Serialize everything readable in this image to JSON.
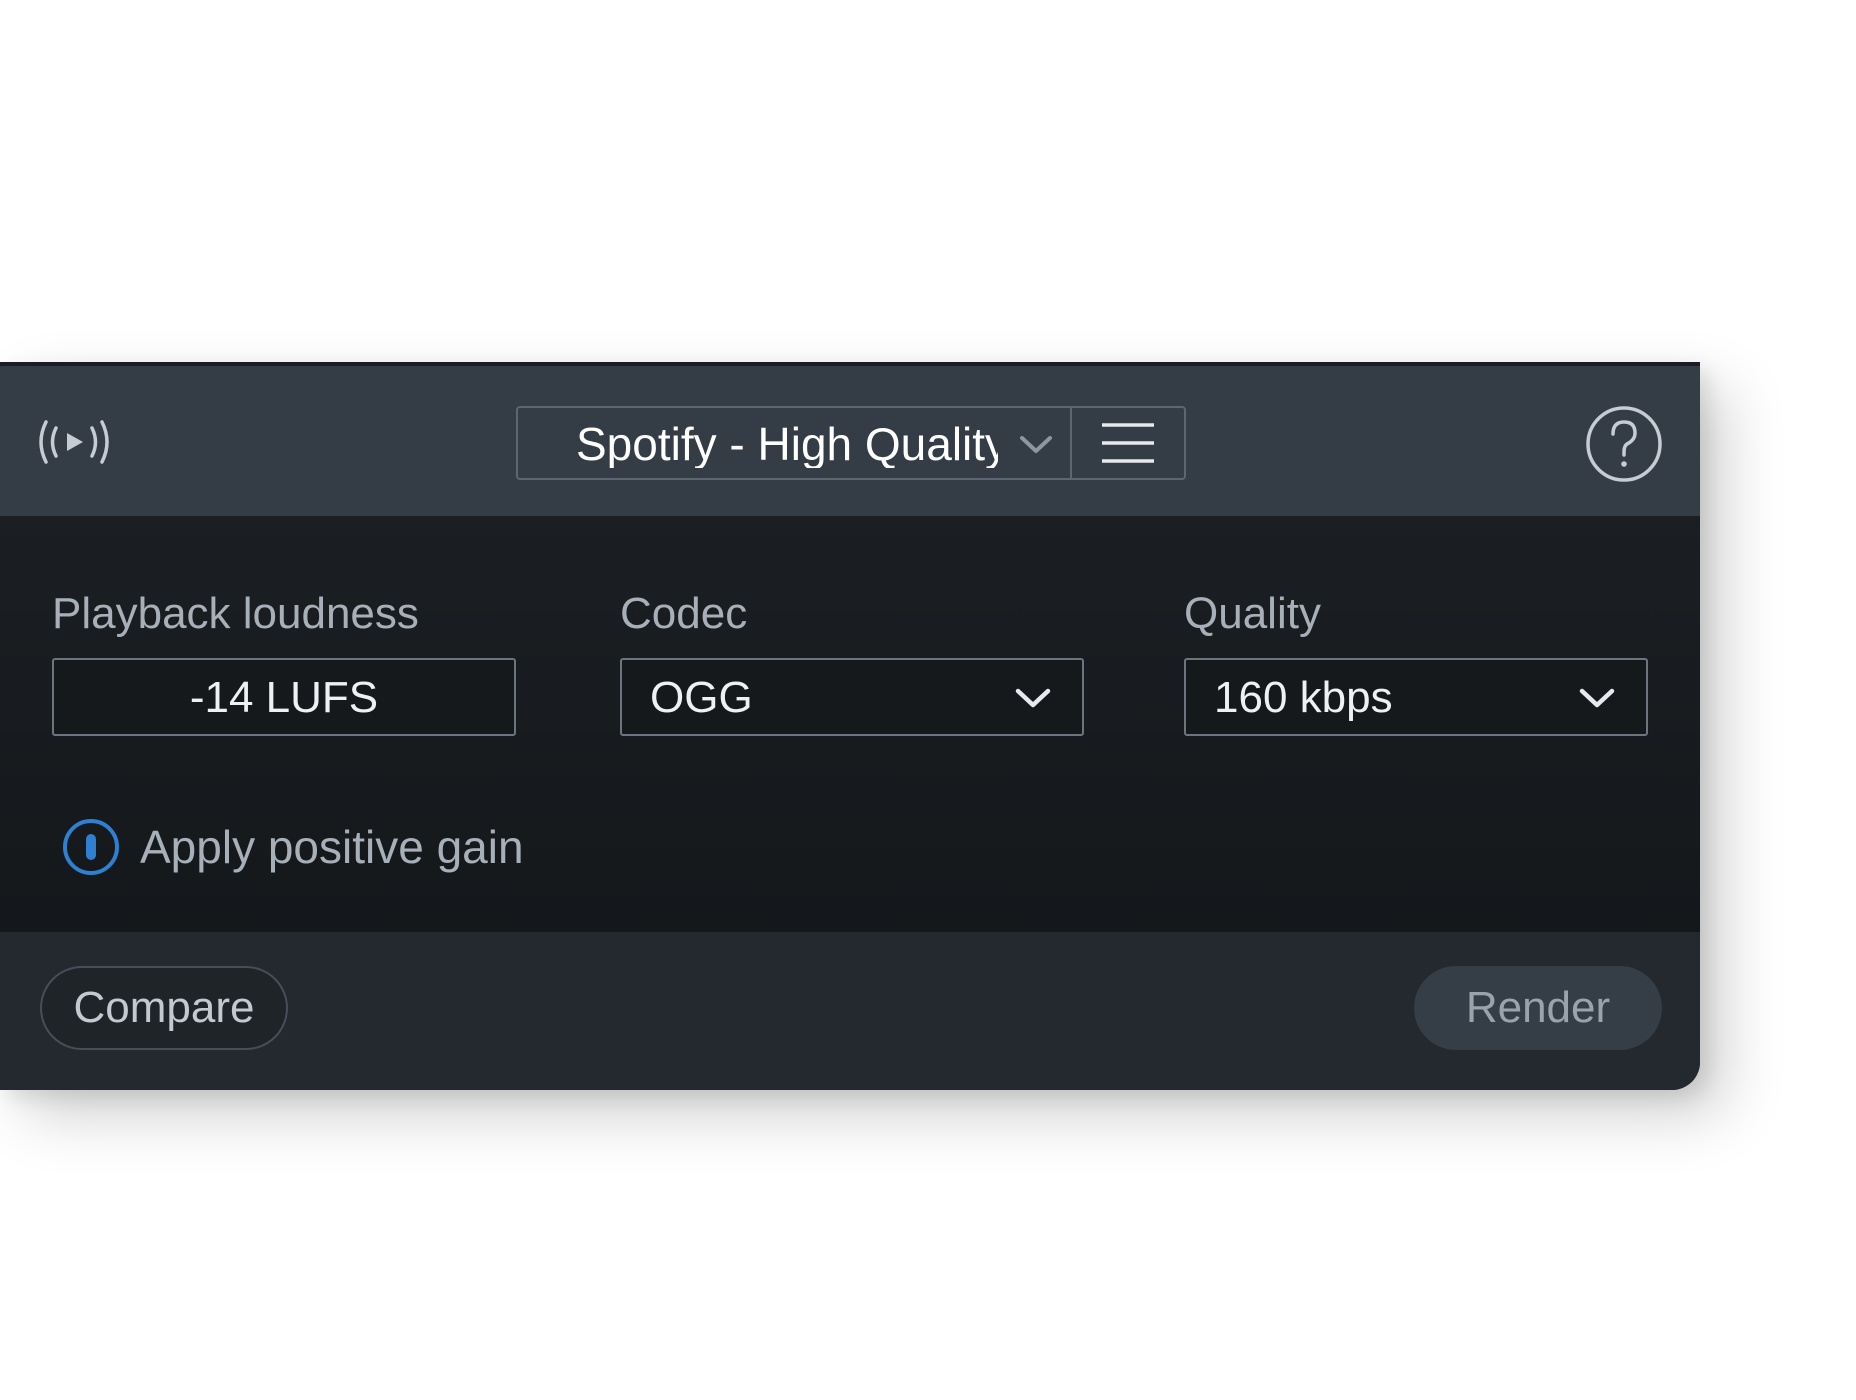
{
  "header": {
    "broadcast_icon": "broadcast-play-icon",
    "preset": {
      "selected": "Spotify - High Quality",
      "chevron_icon": "chevron-down-icon"
    },
    "menu_icon": "hamburger-menu-icon",
    "help_icon": "question-mark-icon"
  },
  "fields": {
    "loudness": {
      "label": "Playback loudness",
      "value": "-14  LUFS"
    },
    "codec": {
      "label": "Codec",
      "value": "OGG",
      "chevron_icon": "chevron-down-icon"
    },
    "quality": {
      "label": "Quality",
      "value": "160 kbps",
      "chevron_icon": "chevron-down-icon"
    }
  },
  "gain": {
    "label": "Apply positive gain",
    "toggle_icon": "toggle-icon",
    "accent_color": "#2f80d0"
  },
  "footer": {
    "compare_label": "Compare",
    "render_label": "Render"
  },
  "colors": {
    "header_bg": "#343c45",
    "body_bg": "#161a1d",
    "footer_bg": "#23292f",
    "label_text": "#a7afb8",
    "value_text": "#eef1f4"
  }
}
